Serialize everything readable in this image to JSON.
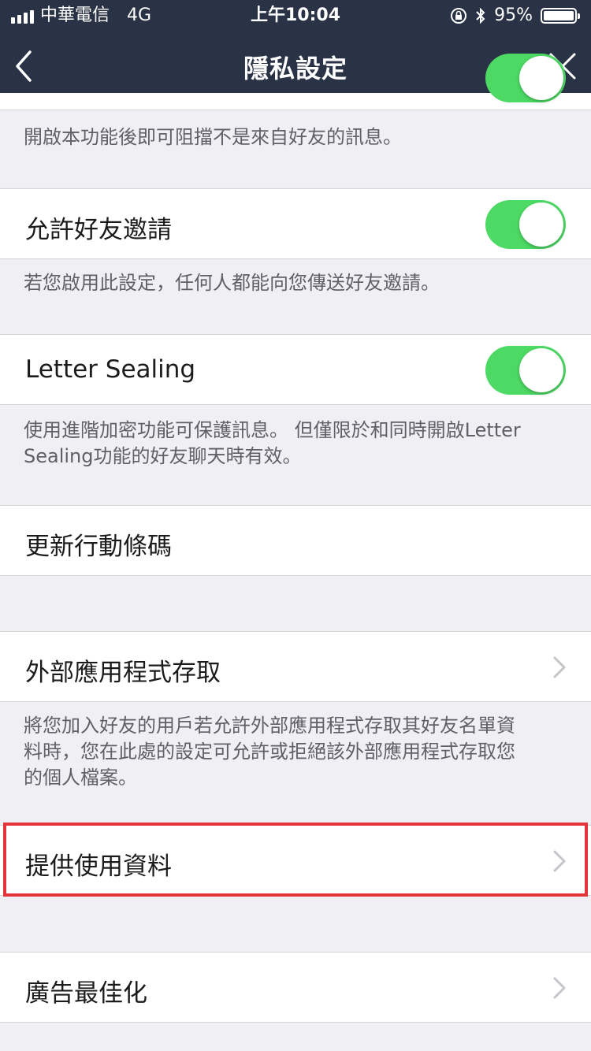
{
  "status_bar": {
    "carrier": "中華電信",
    "network": "4G",
    "time": "上午10:04",
    "battery": "95%",
    "battery_level": 0.95
  },
  "nav": {
    "title": "隱私設定",
    "back_icon": "chevron-left-icon",
    "close_icon": "close-icon"
  },
  "settings": {
    "block_note": "開啟本功能後即可阻擋不是來自好友的訊息。",
    "allow_invite": {
      "label": "允許好友邀請",
      "enabled": true,
      "note": "若您啟用此設定，任何人都能向您傳送好友邀請。"
    },
    "letter_sealing": {
      "label": "Letter Sealing",
      "enabled": true,
      "note_line1": "使用進階加密功能可保護訊息。 但僅限於和同時開啟Letter",
      "note_line2": "Sealing功能的好友聊天時有效。"
    },
    "update_qr": {
      "label": "更新行動條碼"
    },
    "external_apps": {
      "label": "外部應用程式存取",
      "note_line1": "將您加入好友的用戶若允許外部應用程式存取其好友名單資",
      "note_line2": "料時，您在此處的設定可允許或拒絕該外部應用程式存取您",
      "note_line3": "的個人檔案。"
    },
    "provide_usage": {
      "label": "提供使用資料"
    },
    "ad_optimize": {
      "label": "廣告最佳化"
    }
  },
  "colors": {
    "header_bg": "#2a3345",
    "toggle_on": "#4cd964",
    "highlight": "#e5333b",
    "background": "#efeff4"
  }
}
